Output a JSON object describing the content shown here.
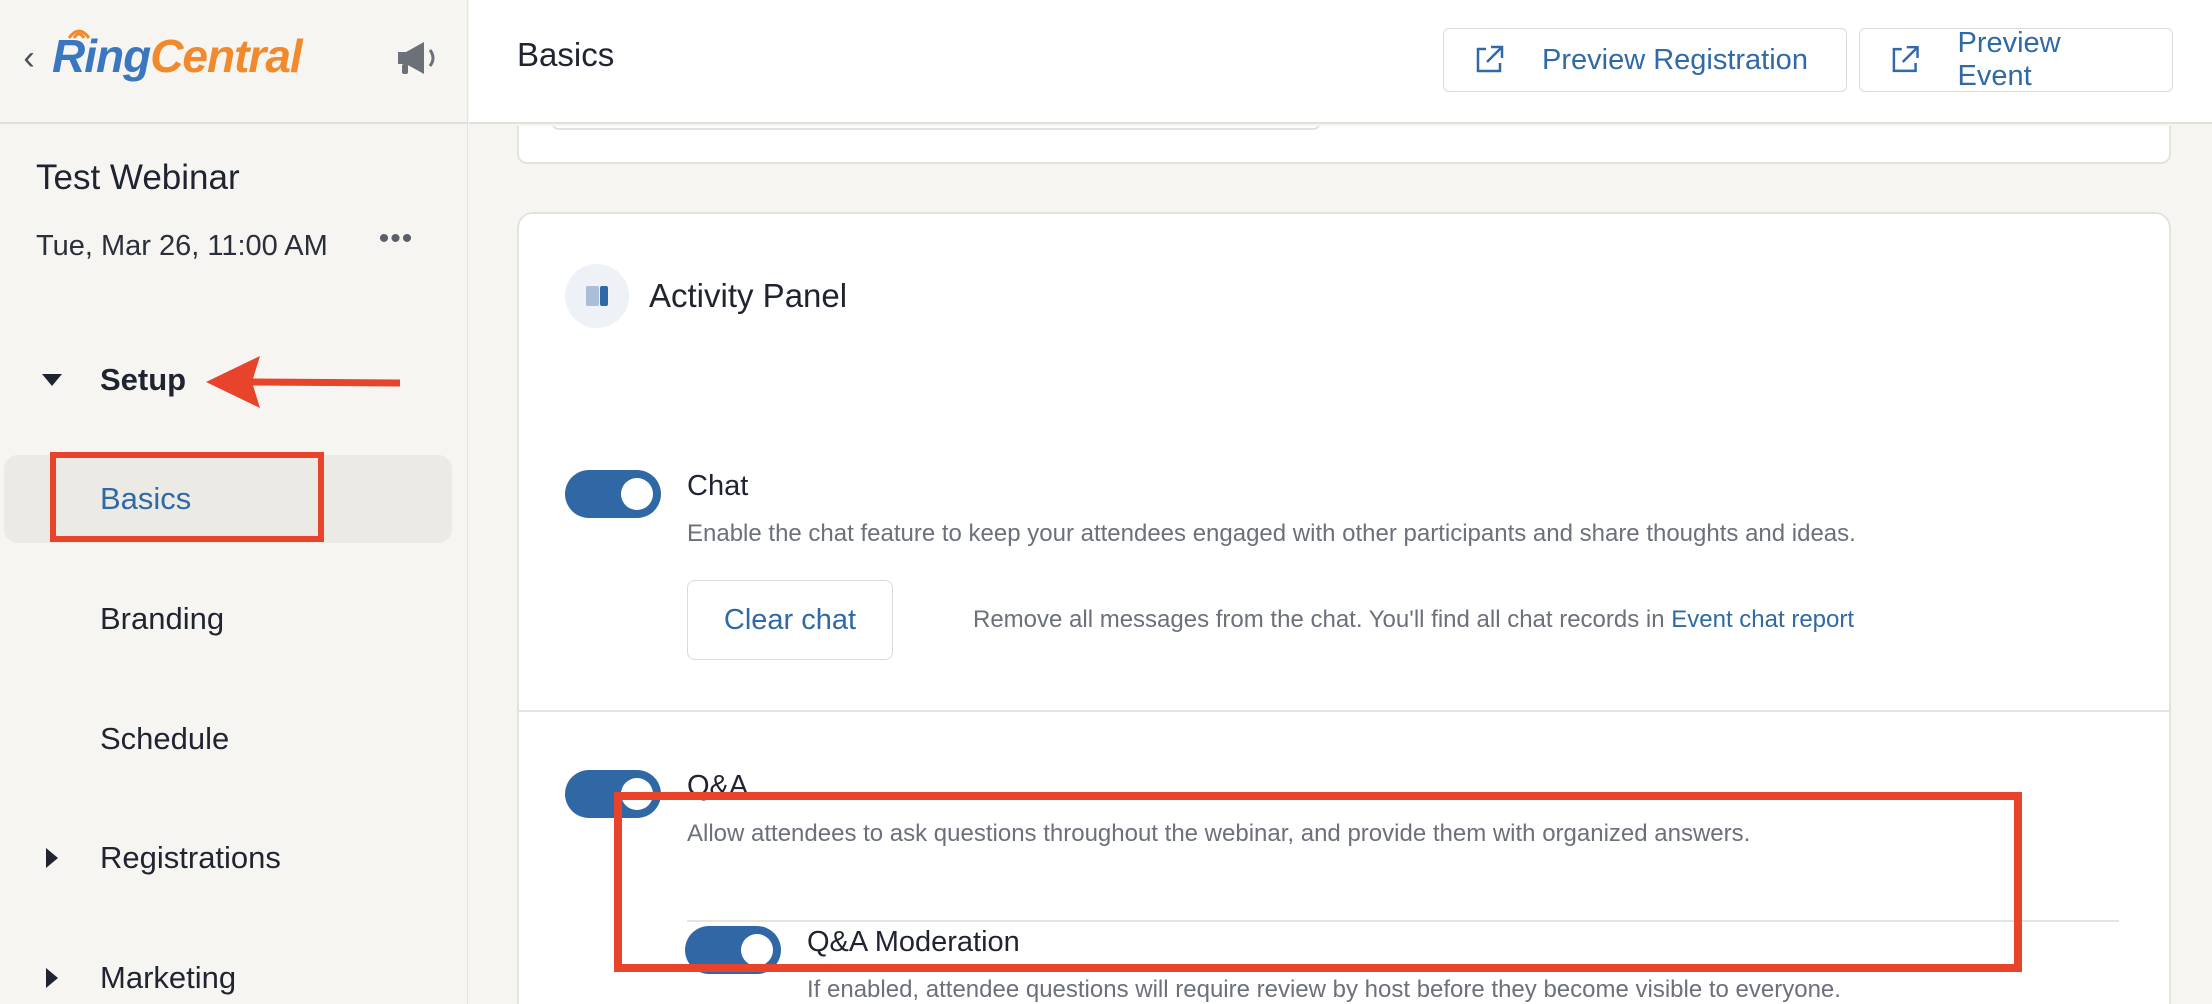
{
  "sidebar": {
    "logo": {
      "ring": "Ring",
      "central": "Central"
    },
    "event_title": "Test Webinar",
    "event_date": "Tue, Mar 26, 11:00 AM",
    "more_label": "•••",
    "sections": [
      {
        "label": "Setup",
        "expanded": true
      },
      {
        "label": "Registrations",
        "expanded": false
      },
      {
        "label": "Marketing",
        "expanded": false
      }
    ],
    "setup_items": [
      {
        "label": "Basics",
        "active": true
      },
      {
        "label": "Branding",
        "active": false
      },
      {
        "label": "Schedule",
        "active": false
      }
    ]
  },
  "header": {
    "title": "Basics",
    "preview_registration": "Preview Registration",
    "preview_event": "Preview Event"
  },
  "activity_panel": {
    "title": "Activity Panel",
    "chat": {
      "title": "Chat",
      "enabled": true,
      "description": "Enable the chat feature to keep your attendees engaged with other participants and share thoughts and ideas.",
      "clear_button": "Clear chat",
      "clear_note": "Remove all messages from the chat. You'll find all chat records in ",
      "report_link": "Event chat report"
    },
    "qa": {
      "title": "Q&A",
      "enabled": true,
      "description": "Allow attendees to ask questions throughout the webinar, and provide them with organized answers."
    },
    "qa_moderation": {
      "title": "Q&A Moderation",
      "enabled": true,
      "description": "If enabled, attendee questions will require review by host before they become visible to everyone."
    }
  },
  "colors": {
    "accent": "#2f6aa6",
    "toggle_on": "#2f68a4",
    "annotation_red": "#e8432b",
    "logo_blue": "#3b77c0",
    "logo_orange": "#f08a2c"
  }
}
